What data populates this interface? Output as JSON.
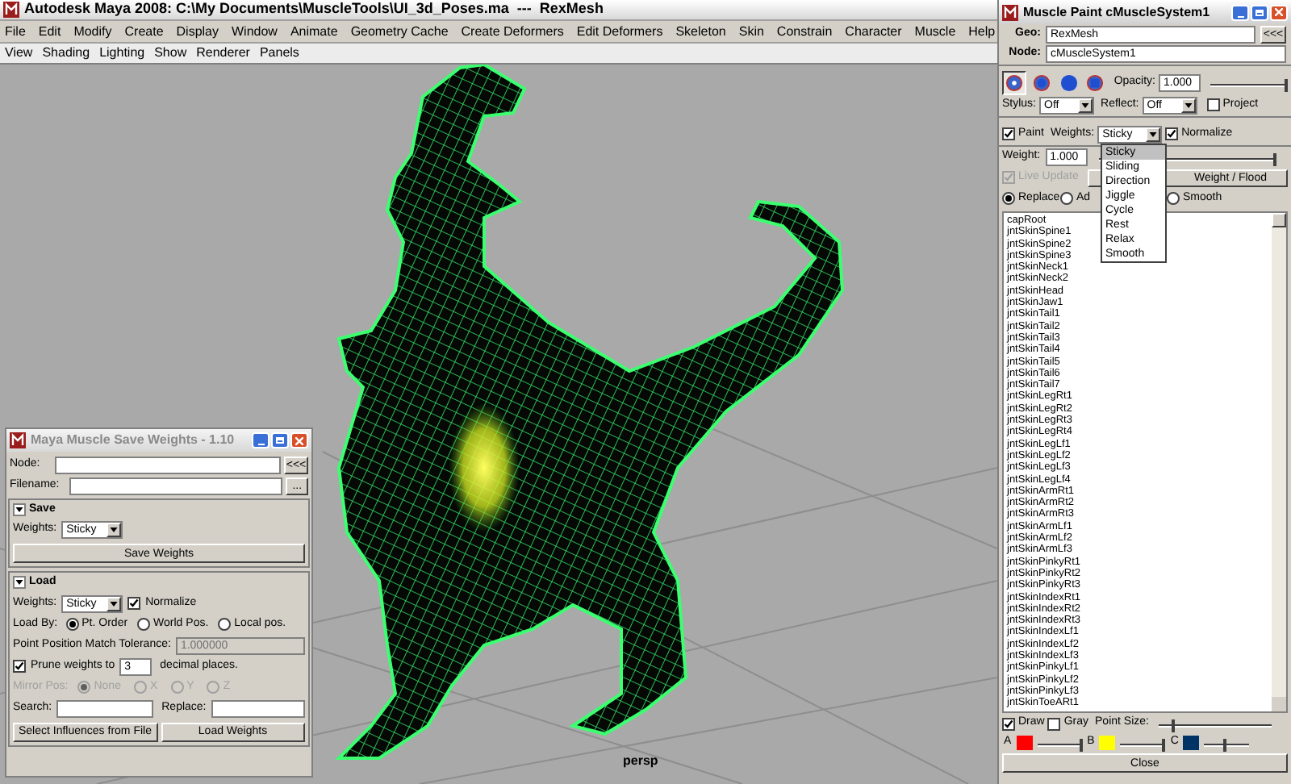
{
  "window": {
    "title": "Autodesk Maya 2008: C:\\My Documents\\MuscleTools\\UI_3d_Poses.ma  ---  RexMesh"
  },
  "menu_bar": [
    "File",
    "Edit",
    "Modify",
    "Create",
    "Display",
    "Window",
    "Animate",
    "Geometry Cache",
    "Create Deformers",
    "Edit Deformers",
    "Skeleton",
    "Skin",
    "Constrain",
    "Character",
    "Muscle",
    "Help"
  ],
  "panel_menu": [
    "View",
    "Shading",
    "Lighting",
    "Show",
    "Renderer",
    "Panels"
  ],
  "viewport": {
    "camera_label": "persp"
  },
  "save_weights_dialog": {
    "title": "Maya Muscle Save Weights - 1.10",
    "node_label": "Node:",
    "node_button": "<<<",
    "filename_label": "Filename:",
    "filename_button": "...",
    "save_section": {
      "title": "Save",
      "expanded": true,
      "weights_label": "Weights:",
      "weights_value": "Sticky",
      "button": "Save Weights"
    },
    "load_section": {
      "title": "Load",
      "expanded": true,
      "weights_label": "Weights:",
      "weights_value": "Sticky",
      "normalize": {
        "label": "Normalize",
        "checked": true
      },
      "load_by_label": "Load By:",
      "load_by_options": [
        {
          "label": "Pt. Order",
          "selected": true
        },
        {
          "label": "World Pos.",
          "selected": false
        },
        {
          "label": "Local pos.",
          "selected": false
        }
      ],
      "tolerance": {
        "label": "Point Position Match Tolerance:",
        "value": "1.000000",
        "disabled": true
      },
      "prune": {
        "label": "Prune weights to",
        "checked": true,
        "value": "3",
        "suffix": "decimal places."
      },
      "mirror": {
        "label": "Mirror Pos:",
        "disabled": true,
        "options": [
          {
            "label": "None",
            "selected": true
          },
          {
            "label": "X",
            "selected": false
          },
          {
            "label": "Y",
            "selected": false
          },
          {
            "label": "Z",
            "selected": false
          }
        ]
      },
      "search_label": "Search:",
      "replace_label": "Replace:",
      "buttons": [
        "Select Influences from File",
        "Load Weights"
      ]
    }
  },
  "paint_panel": {
    "title": "Muscle Paint cMuscleSystem1",
    "geo_label": "Geo:",
    "geo_value": "RexMesh",
    "geo_button": "<<<",
    "node_label": "Node:",
    "node_value": "cMuscleSystem1",
    "brushes": [
      {
        "kind": "dot",
        "selected": true
      },
      {
        "kind": "round",
        "selected": false
      },
      {
        "kind": "full",
        "selected": false
      },
      {
        "kind": "square",
        "selected": false
      }
    ],
    "opacity": {
      "label": "Opacity:",
      "value": "1.000",
      "level": 1
    },
    "stylus_label": "Stylus:",
    "stylus_value": "Off",
    "reflect_label": "Reflect:",
    "reflect_value": "Off",
    "project": {
      "label": "Project",
      "checked": false
    },
    "paint": {
      "label": "Paint",
      "checked": true
    },
    "weights_label": "Weights:",
    "weights_value": "Sticky",
    "normalize": {
      "label": "Normalize",
      "checked": true
    },
    "weights_menu": [
      {
        "label": "Sticky",
        "selected": true
      },
      {
        "label": "Sliding",
        "selected": false
      },
      {
        "label": "Direction",
        "selected": false
      },
      {
        "label": "Jiggle",
        "selected": false
      },
      {
        "label": "Cycle",
        "selected": false
      },
      {
        "label": "Rest",
        "selected": false
      },
      {
        "label": "Relax",
        "selected": false
      },
      {
        "label": "Smooth",
        "selected": false
      }
    ],
    "weight": {
      "label": "Weight:",
      "value": "1.000",
      "level": 1
    },
    "live_update": {
      "label": "Live Update",
      "checked": true,
      "disabled": true
    },
    "flood_button": "Weight / Flood",
    "modes": [
      {
        "label": "Replace",
        "selected": true
      },
      {
        "label": "Ad",
        "selected": false
      },
      {
        "label": "Smooth",
        "selected": false
      }
    ],
    "influences": [
      "capRoot",
      "jntSkinSpine1",
      "jntSkinSpine2",
      "jntSkinSpine3",
      "jntSkinNeck1",
      "jntSkinNeck2",
      "jntSkinHead",
      "jntSkinJaw1",
      "jntSkinTail1",
      "jntSkinTail2",
      "jntSkinTail3",
      "jntSkinTail4",
      "jntSkinTail5",
      "jntSkinTail6",
      "jntSkinTail7",
      "jntSkinLegRt1",
      "jntSkinLegRt2",
      "jntSkinLegRt3",
      "jntSkinLegRt4",
      "jntSkinLegLf1",
      "jntSkinLegLf2",
      "jntSkinLegLf3",
      "jntSkinLegLf4",
      "jntSkinArmRt1",
      "jntSkinArmRt2",
      "jntSkinArmRt3",
      "jntSkinArmLf1",
      "jntSkinArmLf2",
      "jntSkinArmLf3",
      "jntSkinPinkyRt1",
      "jntSkinPinkyRt2",
      "jntSkinPinkyRt3",
      "jntSkinIndexRt1",
      "jntSkinIndexRt2",
      "jntSkinIndexRt3",
      "jntSkinIndexLf1",
      "jntSkinIndexLf2",
      "jntSkinIndexLf3",
      "jntSkinPinkyLf1",
      "jntSkinPinkyLf2",
      "jntSkinPinkyLf3",
      "jntSkinToeARt1"
    ],
    "draw": {
      "label": "Draw",
      "checked": true
    },
    "gray": {
      "label": "Gray",
      "checked": false
    },
    "point_size": {
      "label": "Point Size:",
      "level": 0.15
    },
    "colors": [
      {
        "label": "A",
        "color": "#ff0000",
        "level": 1
      },
      {
        "label": "B",
        "color": "#ffff00",
        "level": 1
      },
      {
        "label": "C",
        "color": "#003366",
        "level": 0.5
      }
    ],
    "close_button": "Close"
  }
}
